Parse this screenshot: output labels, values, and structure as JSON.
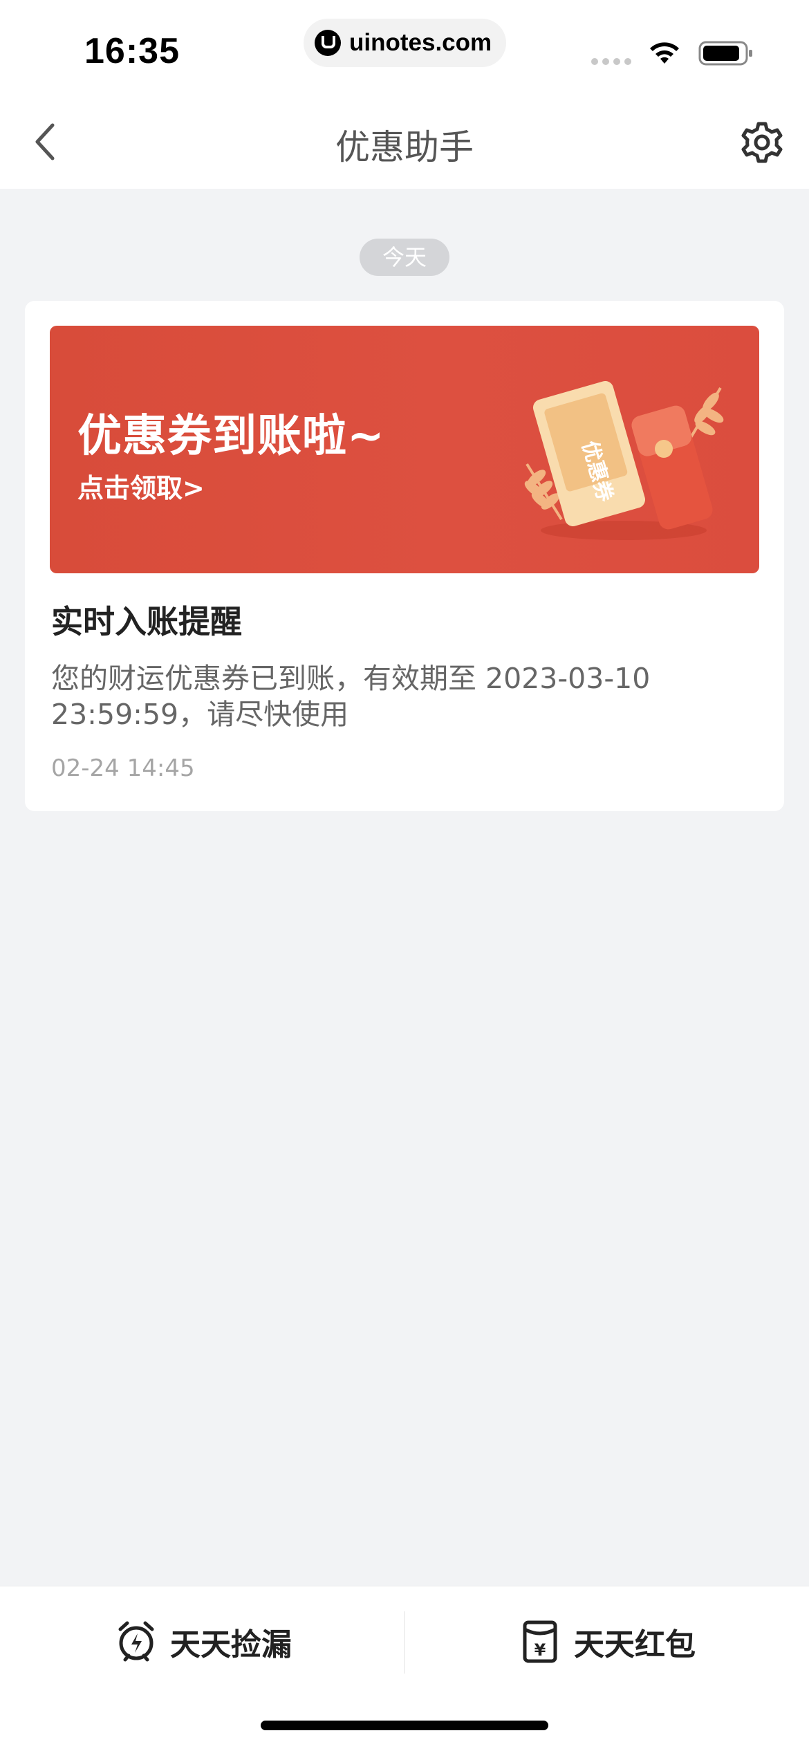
{
  "status_bar": {
    "time": "16:35",
    "url": "uinotes.com",
    "icons": [
      "signal-icon",
      "wifi-icon",
      "battery-icon"
    ]
  },
  "nav": {
    "title": "优惠助手",
    "back_icon": "chevron-left-icon",
    "settings_icon": "gear-icon"
  },
  "date_label": "今天",
  "message": {
    "banner_title": "优惠券到账啦~",
    "banner_subtitle": "点击领取>",
    "banner_art_text": "优惠券",
    "title": "实时入账提醒",
    "body": "您的财运优惠券已到账，有效期至 2023-03-10 23:59:59，请尽快使用",
    "time": "02-24 14:45"
  },
  "bottom_tabs": [
    {
      "label": "天天捡漏",
      "icon": "alarm-clock-icon"
    },
    {
      "label": "天天红包",
      "icon": "red-envelope-icon"
    }
  ],
  "colors": {
    "banner_red": "#dd5040",
    "page_background": "#f2f3f5",
    "date_pill": "#d4d5d8"
  }
}
